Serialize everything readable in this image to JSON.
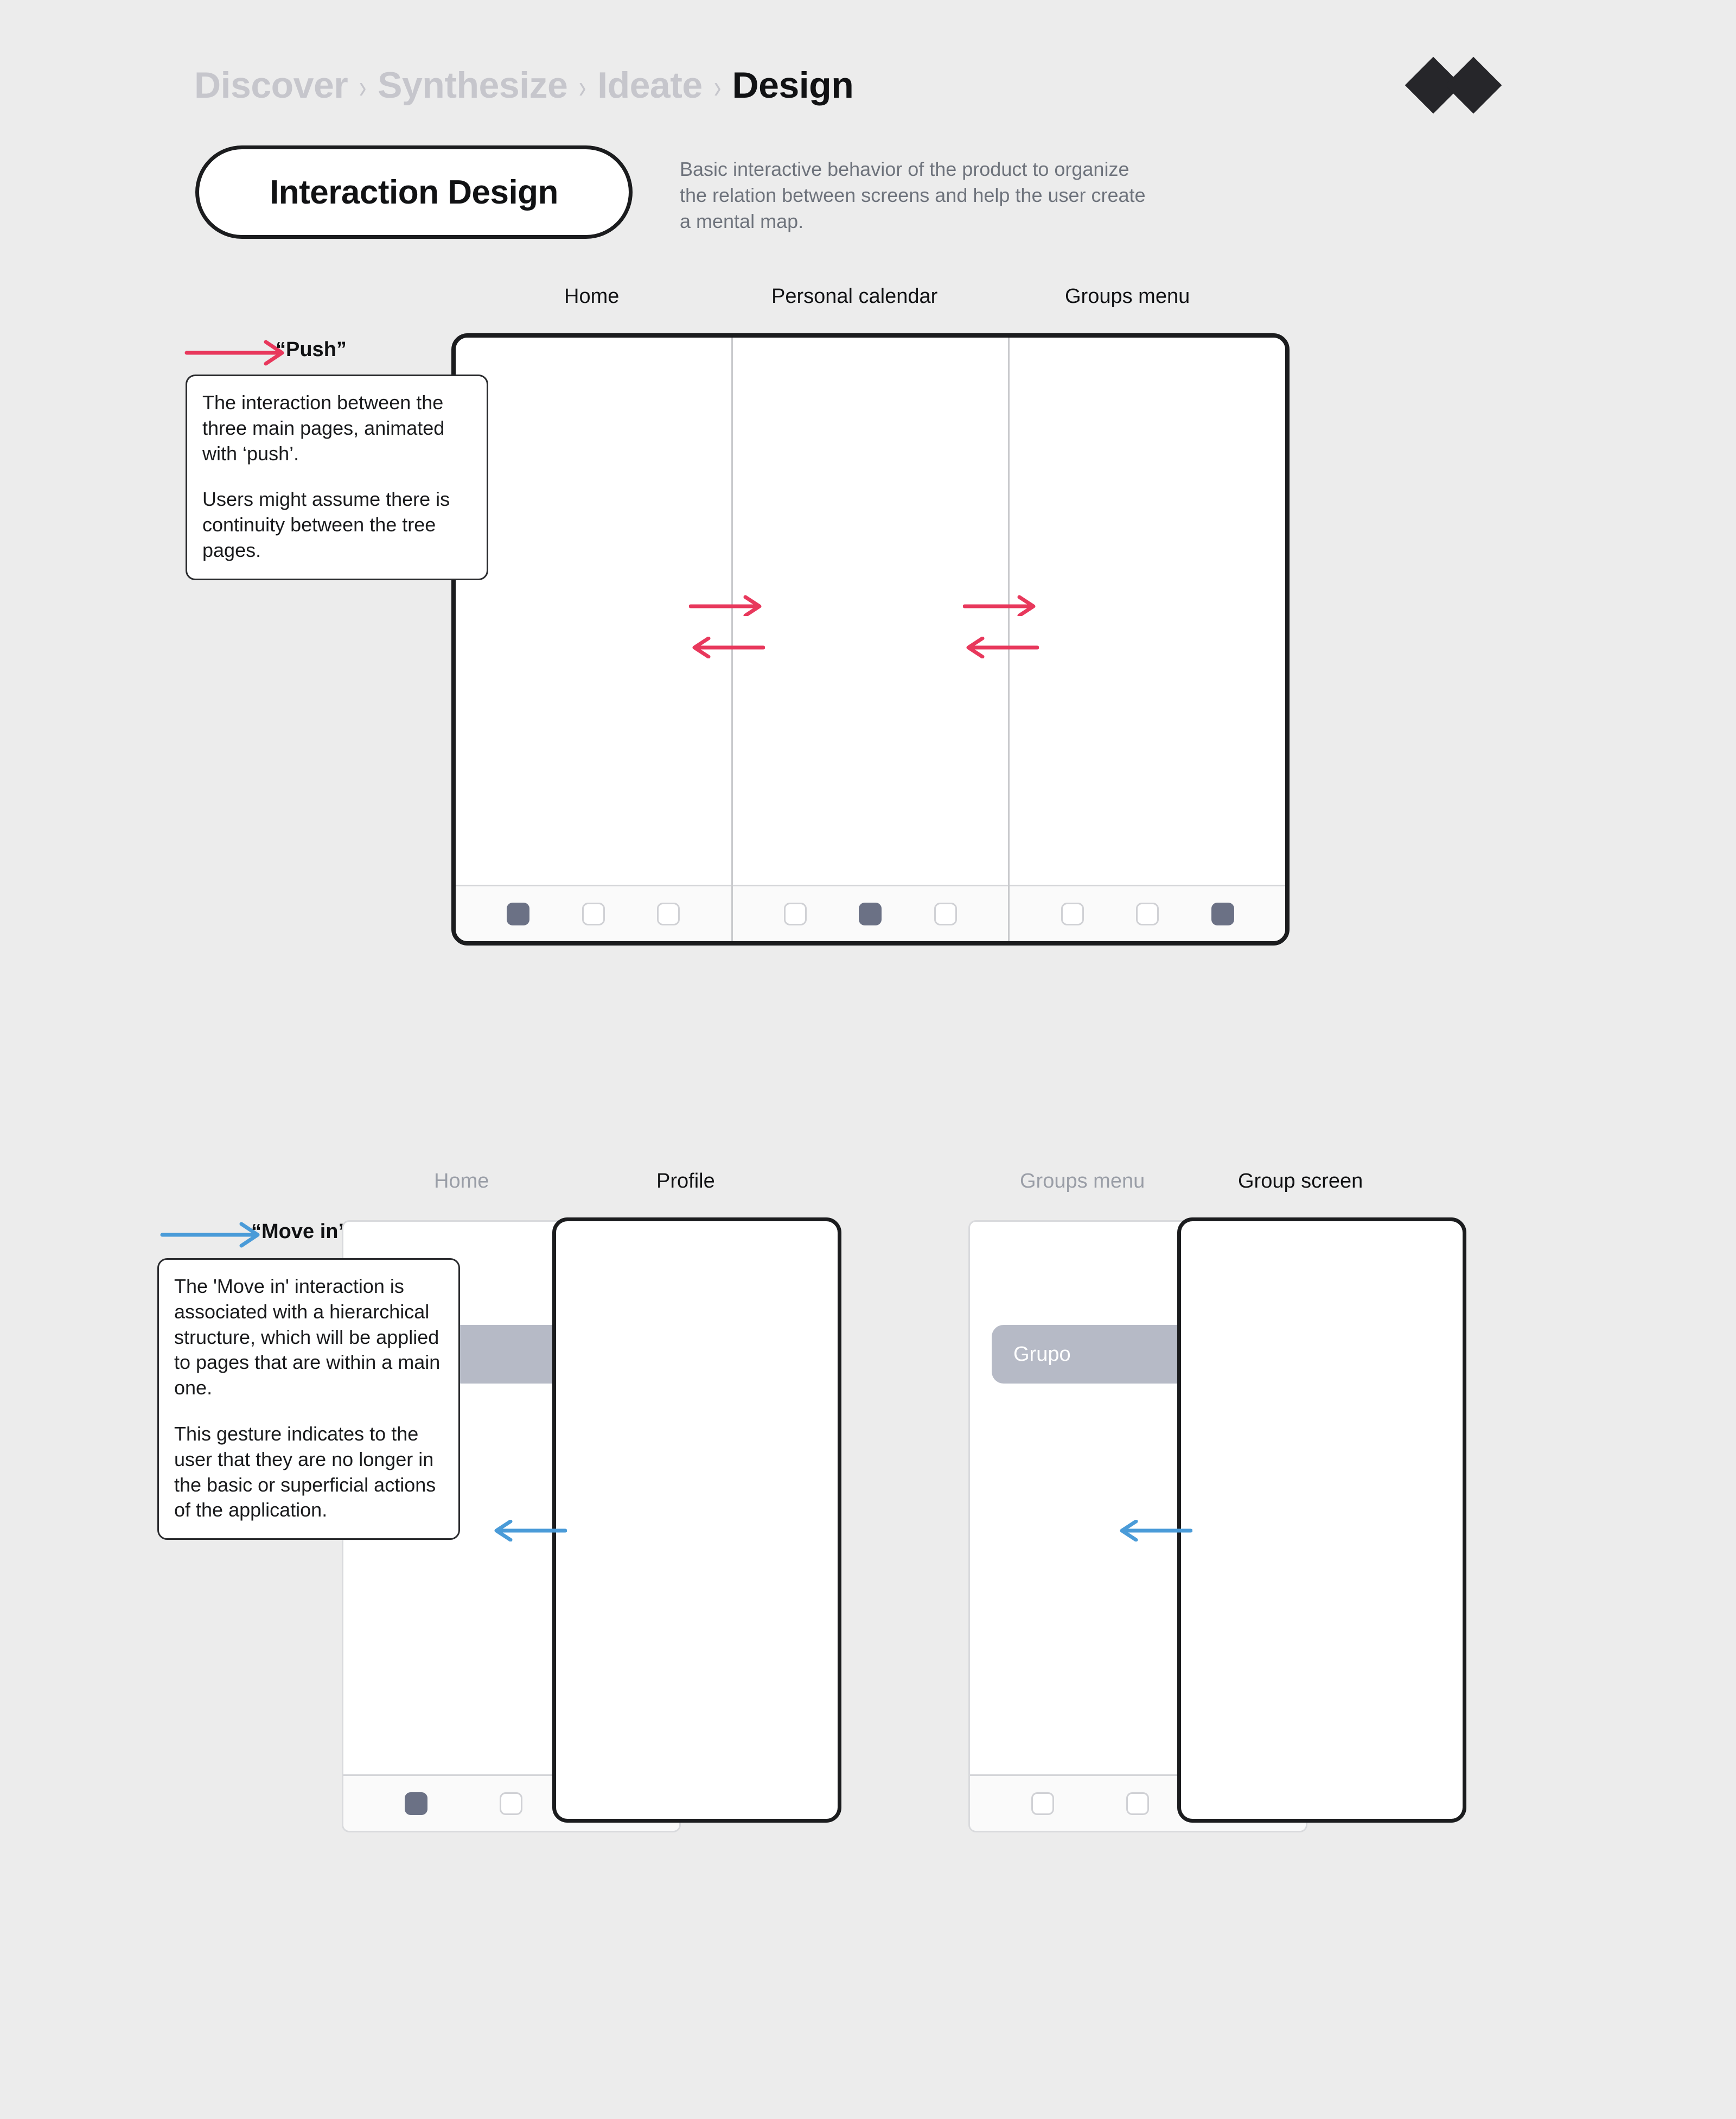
{
  "breadcrumb": {
    "items": [
      {
        "label": "Discover",
        "active": false
      },
      {
        "label": "Synthesize",
        "active": false
      },
      {
        "label": "Ideate",
        "active": false
      },
      {
        "label": "Design",
        "active": true
      }
    ],
    "separator": "›"
  },
  "header": {
    "title": "Interaction Design",
    "subtitle": "Basic interactive behavior of the product to organize the relation between screens and help the user create a mental map.",
    "logo_name": "double-diamond-logo"
  },
  "sections": [
    {
      "id": "push",
      "annotation_label": "“Push”",
      "arrow_color": "#e8385c",
      "note": [
        "The interaction between the three main pages, animated with ‘push’.",
        "Users might assume there is continuity between the tree pages."
      ],
      "screen_labels": [
        {
          "label": "Home",
          "muted": false
        },
        {
          "label": "Personal calendar",
          "muted": false
        },
        {
          "label": "Groups menu",
          "muted": false
        }
      ],
      "panes": [
        {
          "name": "Home",
          "active_tab": 0,
          "tabs": 3
        },
        {
          "name": "Personal calendar",
          "active_tab": 1,
          "tabs": 3
        },
        {
          "name": "Groups menu",
          "active_tab": 2,
          "tabs": 3
        }
      ]
    },
    {
      "id": "move-in",
      "annotation_label": "“Move in”",
      "arrow_color": "#4a9bd8",
      "note": [
        "The 'Move in' interaction is associated with a hierarchical structure, which will be applied to pages that are within a main one.",
        "This gesture indicates to the user that they are no longer in the basic or superficial actions of the application."
      ],
      "pairs": [
        {
          "back_label": "Home",
          "back_muted": true,
          "front_label": "Profile",
          "front_muted": false,
          "back_active_tab": 0,
          "card_label": null
        },
        {
          "back_label": "Groups menu",
          "back_muted": true,
          "front_label": "Group screen",
          "front_muted": false,
          "back_active_tab": 2,
          "card_label": "Grupo"
        }
      ]
    }
  ],
  "colors": {
    "background": "#ececec",
    "ink": "#111214",
    "muted": "#9a9ea7",
    "push_arrow": "#e8385c",
    "move_arrow": "#4a9bd8",
    "tab_active": "#6b7185",
    "card": "#b6bac6"
  }
}
